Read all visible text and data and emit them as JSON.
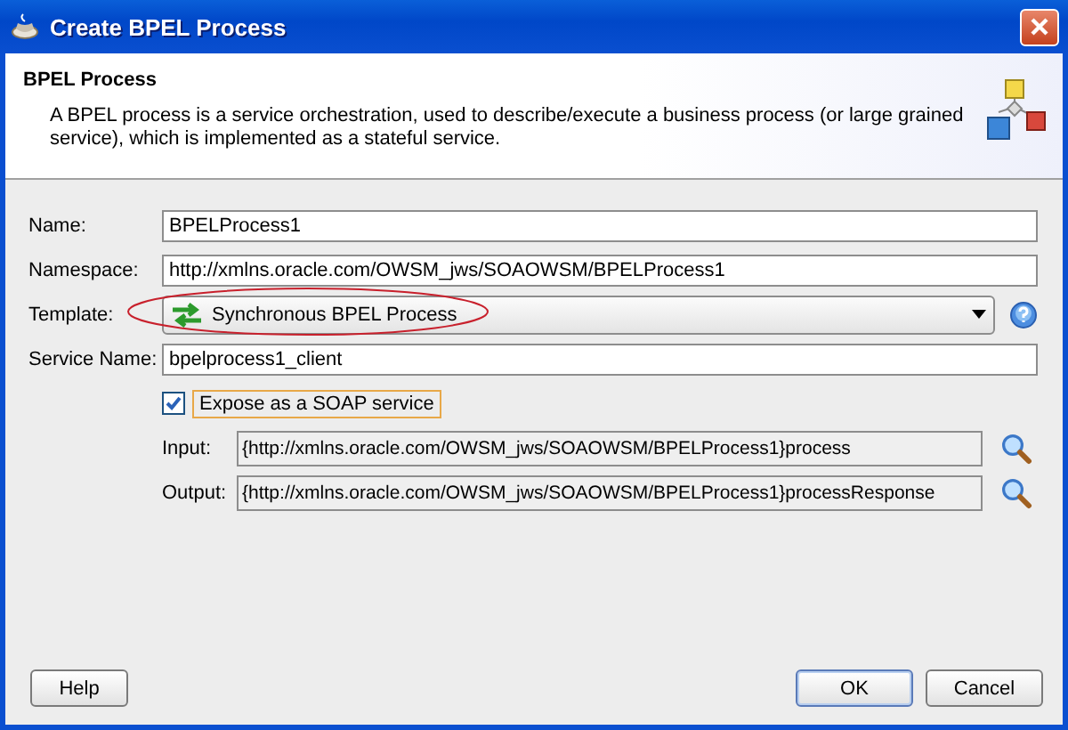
{
  "window": {
    "title": "Create BPEL Process"
  },
  "header": {
    "title": "BPEL Process",
    "description": "A BPEL process is a service orchestration, used to describe/execute a business process (or large grained service), which is implemented as a stateful service."
  },
  "fields": [
    {
      "kind": "text",
      "label": "Name:",
      "value": "BPELProcess1"
    },
    {
      "kind": "text",
      "label": "Namespace:",
      "value": "http://xmlns.oracle.com/OWSM_jws/SOAOWSM/BPELProcess1"
    },
    {
      "kind": "combo",
      "label": "Template:",
      "value": "Synchronous BPEL Process",
      "highlighted": true
    },
    {
      "kind": "text",
      "label": "Service Name:",
      "value": "bpelprocess1_client"
    }
  ],
  "expose": {
    "label": "Expose as a SOAP service",
    "checked": true
  },
  "operations": [
    {
      "label": "Input:",
      "value": "{http://xmlns.oracle.com/OWSM_jws/SOAOWSM/BPELProcess1}process"
    },
    {
      "label": "Output:",
      "value": "{http://xmlns.oracle.com/OWSM_jws/SOAOWSM/BPELProcess1}processResponse"
    }
  ],
  "buttons": [
    {
      "label": "Help",
      "kind": "help"
    },
    {
      "label": "OK",
      "kind": "default"
    },
    {
      "label": "Cancel",
      "kind": "normal"
    }
  ]
}
